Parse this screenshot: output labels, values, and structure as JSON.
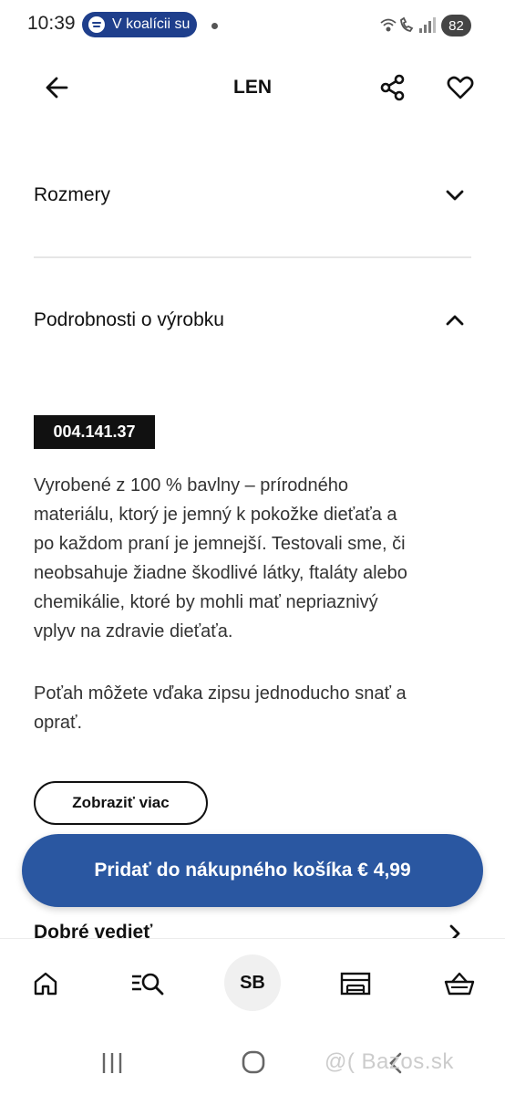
{
  "status_bar": {
    "time": "10:39",
    "spotify_text": "V koalícii su",
    "battery": "82"
  },
  "header": {
    "title": "LEN",
    "back_icon": "arrow-left-icon",
    "share_icon": "share-icon",
    "favorite_icon": "heart-icon"
  },
  "sections": {
    "dimensions": {
      "label": "Rozmery",
      "icon": "chevron-down-icon"
    },
    "details": {
      "label": "Podrobnosti o výrobku",
      "icon": "chevron-up-icon"
    },
    "good_to_know": {
      "label": "Dobré vedieť",
      "icon": "chevron-right-icon"
    }
  },
  "product": {
    "article_number": "004.141.37",
    "description_lines_1": [
      "Vyrobené z 100 % bavlny – prírodného",
      "materiálu, ktorý je jemný k pokožke dieťaťa a",
      "po každom praní je jemnejší. Testovali sme, či",
      "neobsahuje žiadne škodlivé látky, ftaláty alebo",
      "chemikálie, ktoré by mohli mať nepriaznivý",
      "vplyv na zdravie dieťaťa."
    ],
    "description_lines_2": [
      "Poťah môžete vďaka zipsu jednoducho snať a",
      "oprať."
    ],
    "show_more_label": "Zobraziť viac"
  },
  "cart_button": {
    "label": "Pridať do nákupného košíka € 4,99",
    "color": "#2a57a1"
  },
  "bottom_nav": {
    "avatar_initials": "SB",
    "items": [
      "home-icon",
      "search-list-icon",
      "avatar",
      "store-icon",
      "basket-icon"
    ]
  },
  "watermark": "@( Bazos.sk"
}
